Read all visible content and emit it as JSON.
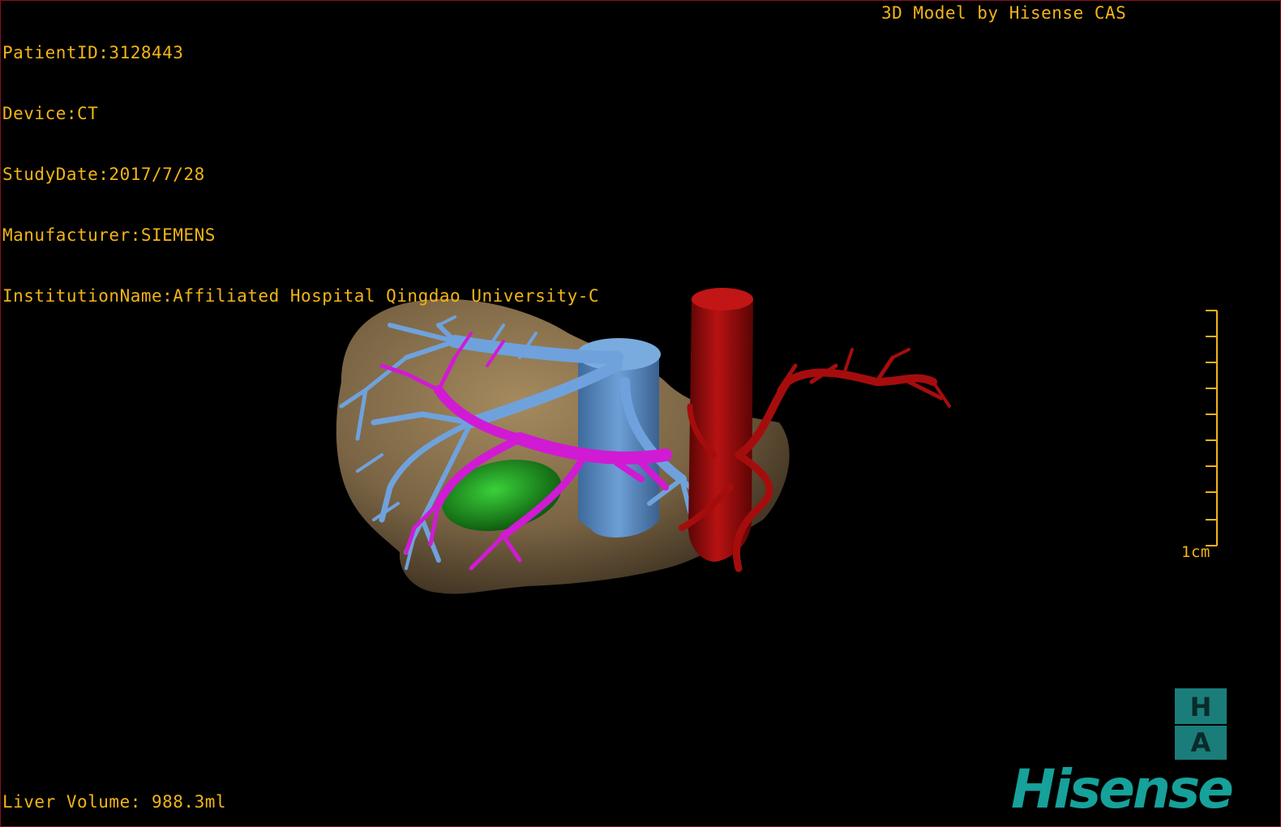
{
  "overlay": {
    "patient_info": [
      "PatientID:3128443",
      "Device:CT",
      "StudyDate:2017/7/28",
      "Manufacturer:SIEMENS",
      "InstitutionName:Affiliated Hospital Qingdao University-C"
    ],
    "title": "3D Model by Hisense CAS",
    "volume": "Liver Volume: 988.3ml"
  },
  "scale_bar": {
    "label": "1cm",
    "tick_count": 10,
    "color": "#f2b418"
  },
  "model": {
    "structures": [
      {
        "name": "liver",
        "color": "#6e5a3c"
      },
      {
        "name": "hepatic-veins",
        "color": "#6fa2dc"
      },
      {
        "name": "portal-vein",
        "color": "#d11ad4"
      },
      {
        "name": "tumor",
        "color": "#1e9a1e"
      },
      {
        "name": "aorta-and-arteries",
        "color": "#a50d0d"
      }
    ]
  },
  "branding": {
    "badge_top": "H",
    "badge_bottom": "A",
    "logo": "Hisense",
    "logo_color": "#16a19a"
  }
}
